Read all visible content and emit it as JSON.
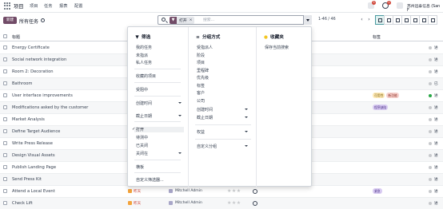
{
  "navbar": {
    "app_name": "项目",
    "menu": [
      "项目",
      "任务",
      "报表",
      "配置"
    ],
    "badges": {
      "chat": "5",
      "activity": "2"
    },
    "company": "苏州远泰信息 (San F"
  },
  "control": {
    "new_label": "新建",
    "title": "所有任务",
    "search": {
      "facet_label": "打开",
      "placeholder": "搜索..."
    },
    "pager": "1-46 / 46"
  },
  "table": {
    "headers": {
      "title": "标题",
      "tags": "标签"
    },
    "rows": [
      {
        "name": "Energy Certificate",
        "status": "进"
      },
      {
        "name": "Social network integration",
        "status": "进"
      },
      {
        "name": "Room 2: Decoration",
        "status": "进"
      },
      {
        "name": "Bathroom",
        "status": "已"
      },
      {
        "name": "User interface improvements",
        "tags": [
          "可用性",
          "新功能"
        ],
        "status": "进"
      },
      {
        "name": "Modifications asked by the customer",
        "tags": [
          "程序缺陷"
        ],
        "status": "进"
      },
      {
        "name": "Market Analysis",
        "status": "进"
      },
      {
        "name": "Define Target Audience",
        "status": "进"
      },
      {
        "name": "Write Press Release",
        "status": "进"
      },
      {
        "name": "Design Visual Assets",
        "status": "进"
      },
      {
        "name": "Publish Landing Page",
        "status": "进"
      },
      {
        "name": "Send Press Kit",
        "status": "进"
      },
      {
        "name": "Attend a Local Event",
        "deadline": "昨天",
        "assignee": "Mitchell Admin",
        "tags": [
          "紧急"
        ],
        "status": "进"
      },
      {
        "name": "Check Lift",
        "deadline": "昨天",
        "assignee": "Mitchell Admin",
        "status": "进"
      }
    ]
  },
  "panel": {
    "filters": {
      "title": "筛选",
      "items": [
        "我的任务",
        "未指派",
        "私人任务",
        "收藏的项目",
        "受阻中",
        "创建时间",
        "截止日期",
        "打开",
        "待测中",
        "已关闭",
        "关闭在",
        "横板",
        "自定义筛选器..."
      ]
    },
    "groupby": {
      "title": "分组方式",
      "items": [
        "受指派人",
        "阶段",
        "项目",
        "里程碑",
        "优先级",
        "标签",
        "客户",
        "公司",
        "创建时间",
        "截止日期",
        "权益",
        "自定义分组"
      ]
    },
    "favorites": {
      "title": "收藏夹",
      "items": [
        "保存当前搜索"
      ]
    }
  },
  "colors": {
    "brand": "#714b67",
    "status_green": "#28a745",
    "status_gray": "#c7c9cc"
  }
}
